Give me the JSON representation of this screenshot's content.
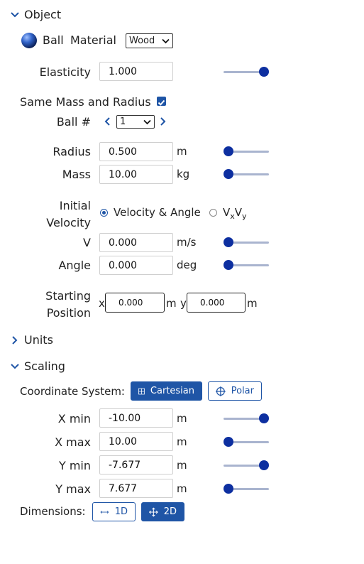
{
  "sections": {
    "object": "Object",
    "units": "Units",
    "scaling": "Scaling"
  },
  "object": {
    "ball_label": "Ball",
    "material_label": "Material",
    "material_value": "Wood",
    "elasticity": {
      "label": "Elasticity",
      "value": "1.000",
      "slider_fraction": 1.0
    },
    "same_mass_radius": {
      "label": "Same Mass and Radius",
      "checked": true
    },
    "ball_number": {
      "label": "Ball #",
      "value": "1"
    },
    "radius": {
      "label": "Radius",
      "value": "0.500",
      "unit": "m",
      "slider_fraction": 0.0
    },
    "mass": {
      "label": "Mass",
      "value": "10.00",
      "unit": "kg",
      "slider_fraction": 0.0
    },
    "initial_velocity": {
      "label_line1": "Initial",
      "label_line2": "Velocity",
      "option_velocity_angle": "Velocity & Angle",
      "option_vxvy_main1": "V",
      "option_vxvy_sub1": "x",
      "option_vxvy_main2": "V",
      "option_vxvy_sub2": "y",
      "selected": "Velocity & Angle"
    },
    "v": {
      "label": "V",
      "value": "0.000",
      "unit": "m/s",
      "slider_fraction": 0.0
    },
    "angle": {
      "label": "Angle",
      "value": "0.000",
      "unit": "deg",
      "slider_fraction": 0.0
    },
    "starting_position": {
      "label_line1": "Starting",
      "label_line2": "Position",
      "x_label": "x",
      "x_value": "0.000",
      "x_unit": "m",
      "y_label": "y",
      "y_value": "0.000",
      "y_unit": "m"
    }
  },
  "scaling": {
    "coordinate_system_label": "Coordinate System:",
    "cartesian_label": "Cartesian",
    "polar_label": "Polar",
    "selected_coordinate_system": "Cartesian",
    "xmin": {
      "label": "X min",
      "value": "-10.00",
      "unit": "m",
      "slider_fraction": 1.0
    },
    "xmax": {
      "label": "X max",
      "value": "10.00",
      "unit": "m",
      "slider_fraction": 0.0
    },
    "ymin": {
      "label": "Y min",
      "value": "-7.677",
      "unit": "m",
      "slider_fraction": 1.0
    },
    "ymax": {
      "label": "Y max",
      "value": "7.677",
      "unit": "m",
      "slider_fraction": 0.0
    },
    "dimensions_label": "Dimensions:",
    "dim_1d_label": "1D",
    "dim_2d_label": "2D",
    "selected_dimension": "2D"
  },
  "colors": {
    "accent": "#1f55a6",
    "slider_knob": "#0d2fa0",
    "slider_track": "#a9b4cf"
  }
}
